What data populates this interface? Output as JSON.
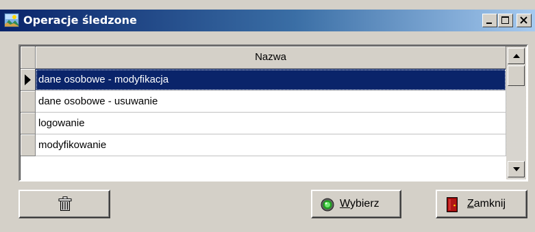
{
  "window": {
    "title": "Operacje śledzone",
    "controls": [
      "minimize-icon",
      "maximize-icon",
      "close-icon"
    ]
  },
  "grid": {
    "column_header": "Nazwa",
    "rows": [
      {
        "name": "dane osobowe - modyfikacja",
        "selected": true
      },
      {
        "name": "dane osobowe - usuwanie",
        "selected": false
      },
      {
        "name": "logowanie",
        "selected": false
      },
      {
        "name": "modyfikowanie",
        "selected": false
      }
    ]
  },
  "buttons": {
    "delete": {
      "icon": "trash-icon"
    },
    "select": {
      "mnemonic": "W",
      "rest": "ybierz",
      "icon": "green-light-icon"
    },
    "close": {
      "mnemonic": "Z",
      "rest": "amknij",
      "icon": "door-icon"
    }
  },
  "colors": {
    "selection": "#0a246a",
    "titlebar_start": "#0a246a",
    "titlebar_end": "#a6caf0",
    "face": "#d4d0c8"
  }
}
